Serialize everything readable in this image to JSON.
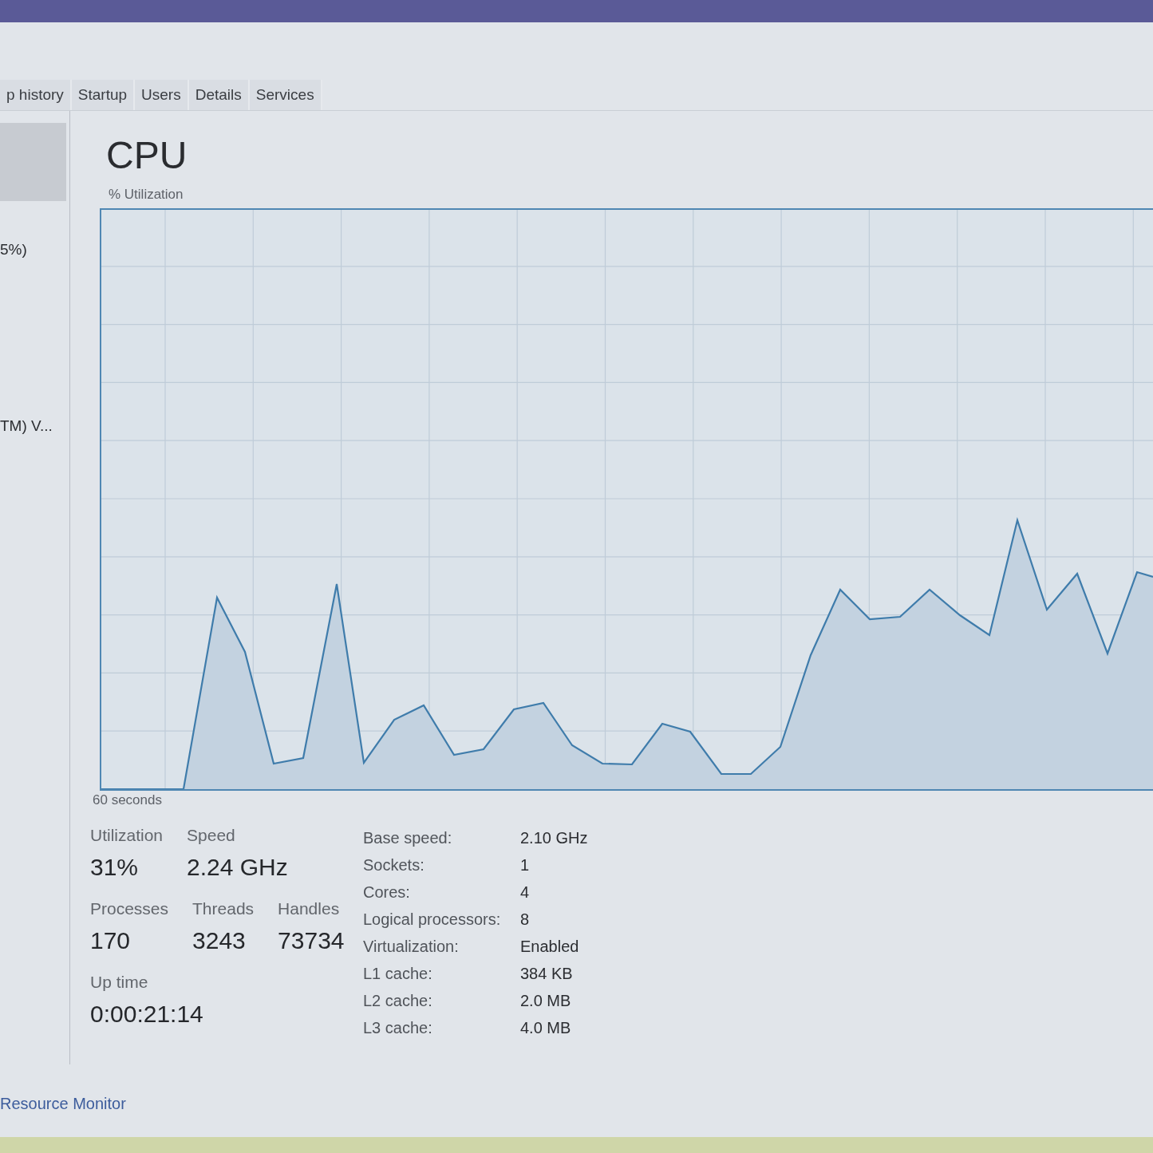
{
  "tabs": [
    {
      "label": "p history",
      "selected": false
    },
    {
      "label": "Startup",
      "selected": false
    },
    {
      "label": "Users",
      "selected": false
    },
    {
      "label": "Details",
      "selected": false
    },
    {
      "label": "Services",
      "selected": false
    }
  ],
  "sidebar": {
    "items": [
      {
        "selected": true
      },
      {
        "label": "5%)",
        "selected": false
      },
      {
        "label": "TM) V...",
        "selected": false
      }
    ]
  },
  "main": {
    "title": "CPU",
    "graph": {
      "ylabel": "% Utilization",
      "xlabel": "60 seconds"
    },
    "stats": [
      [
        {
          "label": "Utilization",
          "value": "31%"
        },
        {
          "label": "Speed",
          "value": "2.24 GHz"
        }
      ],
      [
        {
          "label": "Processes",
          "value": "170"
        },
        {
          "label": "Threads",
          "value": "3243"
        },
        {
          "label": "Handles",
          "value": "73734"
        }
      ],
      [
        {
          "label": "Up time",
          "value": "0:00:21:14"
        }
      ]
    ],
    "details": [
      {
        "label": "Base speed:",
        "value": "2.10 GHz"
      },
      {
        "label": "Sockets:",
        "value": "1"
      },
      {
        "label": "Cores:",
        "value": "4"
      },
      {
        "label": "Logical processors:",
        "value": "8"
      },
      {
        "label": "Virtualization:",
        "value": "Enabled"
      },
      {
        "label": "L1 cache:",
        "value": "384 KB"
      },
      {
        "label": "L2 cache:",
        "value": "2.0 MB"
      },
      {
        "label": "L3 cache:",
        "value": "4.0 MB"
      }
    ]
  },
  "footer": {
    "link": "Resource Monitor"
  }
}
